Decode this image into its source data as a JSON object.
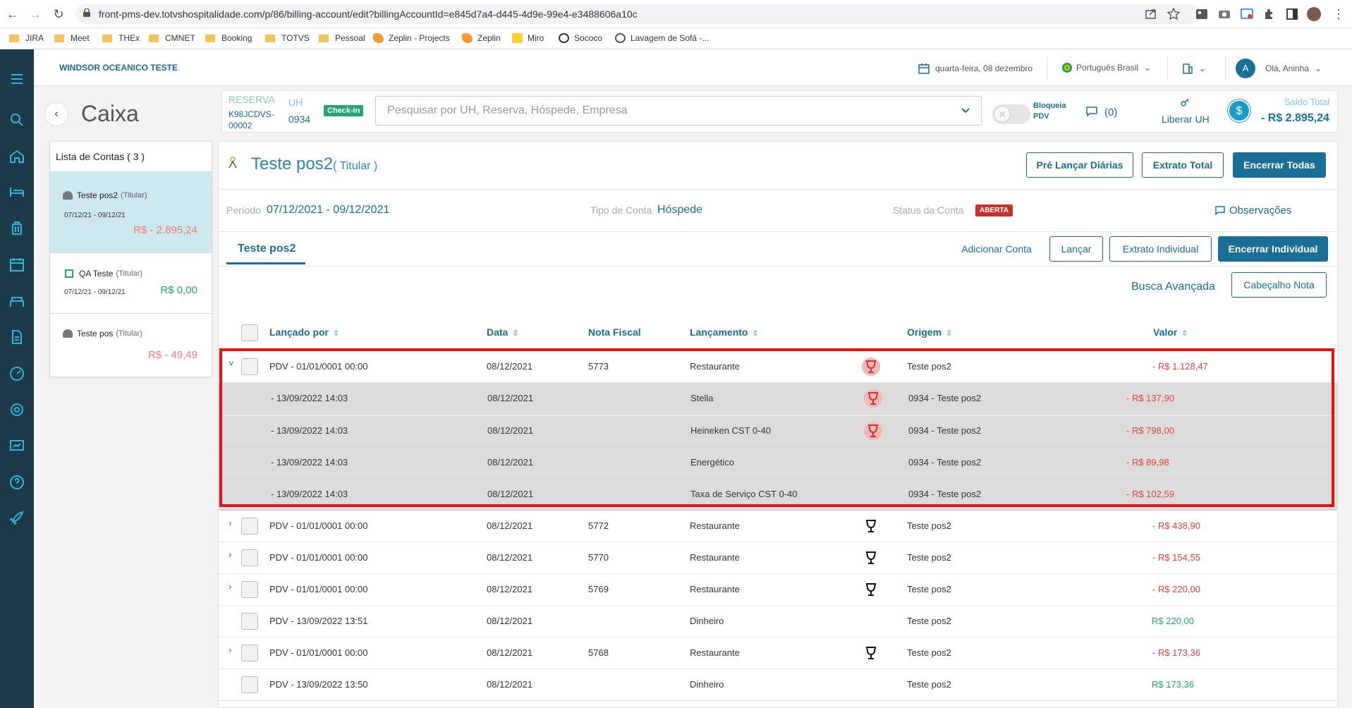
{
  "browser": {
    "url": "front-pms-dev.totvshospitalidade.com/p/86/billing-account/edit?billingAccountId=e845d7a4-d445-4d9e-99e4-e3488606a10c",
    "bookmarks": [
      {
        "label": "JIRA",
        "icon": "folder"
      },
      {
        "label": "Meet",
        "icon": "folder"
      },
      {
        "label": "THEx",
        "icon": "folder"
      },
      {
        "label": "CMNET",
        "icon": "folder"
      },
      {
        "label": "Booking",
        "icon": "folder"
      },
      {
        "label": "TOTVS",
        "icon": "folder"
      },
      {
        "label": "Pessoal",
        "icon": "folder"
      },
      {
        "label": "Zeplin - Projects",
        "icon": "zeplin"
      },
      {
        "label": "Zeplin",
        "icon": "zeplin"
      },
      {
        "label": "Miro",
        "icon": "miro"
      },
      {
        "label": "Sococo",
        "icon": "sococo"
      },
      {
        "label": "Lavagem de Sofá -...",
        "icon": "globe"
      }
    ]
  },
  "header": {
    "hotel": "WINDSOR OCEANICO TESTE",
    "date": "quarta-feira, 08 dezembro",
    "language": "Português Brasil",
    "avatar_letter": "A",
    "greeting": "Olá, Aninha"
  },
  "page": {
    "title": "Caixa"
  },
  "reservation": {
    "reserva_label": "RESERVA",
    "reserva_line1": "K98JCDVS-",
    "reserva_line2": "00002",
    "uh_label": "UH",
    "uh_value": "0934",
    "checkin_badge": "Check-In",
    "search_placeholder": "Pesquisar por UH, Reserva, Hóspede, Empresa",
    "bloqueia_line1": "Bloqueia",
    "bloqueia_line2": "PDV",
    "messages_count": "(0)",
    "liberar_uh": "Liberar UH",
    "saldo_label": "Saldo Total",
    "saldo_value": "- R$ 2.895,24"
  },
  "accounts": {
    "title": "Lista de Contas ( 3 )",
    "items": [
      {
        "name": "Teste pos2",
        "type": "(Titular)",
        "dates": "07/12/21 - 09/12/21",
        "value": "R$ - 2.895,24"
      },
      {
        "name": "QA Teste",
        "type": "(Titular)",
        "dates": "07/12/21 - 09/12/21",
        "value": "R$ 0,00"
      },
      {
        "name": "Teste pos",
        "type": "(Titular)",
        "dates": "",
        "value": "R$ - 49,49"
      }
    ]
  },
  "detail": {
    "name": "Teste pos2",
    "role": "( Titular )",
    "buttons": {
      "pre_lancar": "Pré Lançar Diárias",
      "extrato_total": "Extrato Total",
      "encerrar_todas": "Encerrar Todas"
    },
    "periodo_label": "Período",
    "periodo_value": "07/12/2021 - 09/12/2021",
    "tipo_label": "Tipo de Conta",
    "tipo_value": "Hóspede",
    "status_label": "Status da Conta",
    "status_value": "ABERTA",
    "observacoes": "Observações",
    "tab": "Teste pos2",
    "actions": {
      "adicionar": "Adicionar Conta",
      "lancar": "Lançar",
      "extrato_individual": "Extrato Individual",
      "encerrar_individual": "Encerrar Individual"
    },
    "busca": "Busca Avançada",
    "cabecalho": "Cabeçalho Nota"
  },
  "table": {
    "columns": {
      "lancado": "Lançado por",
      "data": "Data",
      "nota": "Nota Fiscal",
      "lancamento": "Lançamento",
      "origem": "Origem",
      "valor": "Valor"
    },
    "rows": [
      {
        "expand": "˅",
        "check": true,
        "lancado": "PDV - 01/01/0001 00:00",
        "data": "08/12/2021",
        "nota": "5773",
        "lancamento": "Restaurante",
        "icon": "red",
        "origem": "Teste pos2",
        "valor": "- R$ 1.128,47",
        "sub": false
      },
      {
        "expand": "",
        "check": false,
        "lancado": "- 13/09/2022 14:03",
        "data": "08/12/2021",
        "nota": "",
        "lancamento": "Stella",
        "icon": "red",
        "origem": "0934 - Teste pos2",
        "valor": "- R$ 137,90",
        "sub": true
      },
      {
        "expand": "",
        "check": false,
        "lancado": "- 13/09/2022 14:03",
        "data": "08/12/2021",
        "nota": "",
        "lancamento": "Heineken CST 0-40",
        "icon": "red",
        "origem": "0934 - Teste pos2",
        "valor": "- R$ 798,00",
        "sub": true
      },
      {
        "expand": "",
        "check": false,
        "lancado": "- 13/09/2022 14:03",
        "data": "08/12/2021",
        "nota": "",
        "lancamento": "Energético",
        "icon": "",
        "origem": "0934 - Teste pos2",
        "valor": "- R$ 89,98",
        "sub": true
      },
      {
        "expand": "",
        "check": false,
        "lancado": "- 13/09/2022 14:03",
        "data": "08/12/2021",
        "nota": "",
        "lancamento": "Taxa de Serviço CST 0-40",
        "icon": "",
        "origem": "0934 - Teste pos2",
        "valor": "- R$ 102,59",
        "sub": true
      },
      {
        "expand": "›",
        "check": true,
        "lancado": "PDV - 01/01/0001 00:00",
        "data": "08/12/2021",
        "nota": "5772",
        "lancamento": "Restaurante",
        "icon": "black",
        "origem": "Teste pos2",
        "valor": "- R$ 438,90",
        "sub": false
      },
      {
        "expand": "›",
        "check": true,
        "lancado": "PDV - 01/01/0001 00:00",
        "data": "08/12/2021",
        "nota": "5770",
        "lancamento": "Restaurante",
        "icon": "black",
        "origem": "Teste pos2",
        "valor": "- R$ 154,55",
        "sub": false
      },
      {
        "expand": "›",
        "check": true,
        "lancado": "PDV - 01/01/0001 00:00",
        "data": "08/12/2021",
        "nota": "5769",
        "lancamento": "Restaurante",
        "icon": "black",
        "origem": "Teste pos2",
        "valor": "- R$ 220,00",
        "sub": false
      },
      {
        "expand": "",
        "check": true,
        "lancado": "PDV - 13/09/2022 13:51",
        "data": "08/12/2021",
        "nota": "",
        "lancamento": "Dinheiro",
        "icon": "",
        "origem": "Teste pos2",
        "valor": "R$ 220,00",
        "sub": false
      },
      {
        "expand": "›",
        "check": true,
        "lancado": "PDV - 01/01/0001 00:00",
        "data": "08/12/2021",
        "nota": "5768",
        "lancamento": "Restaurante",
        "icon": "black",
        "origem": "Teste pos2",
        "valor": "- R$ 173,36",
        "sub": false
      },
      {
        "expand": "",
        "check": true,
        "lancado": "PDV - 13/09/2022 13:50",
        "data": "08/12/2021",
        "nota": "",
        "lancamento": "Dinheiro",
        "icon": "",
        "origem": "Teste pos2",
        "valor": "R$ 173,36",
        "sub": false
      }
    ]
  },
  "colors": {
    "sidebar": "#1c3a47",
    "primary": "#1a6f96",
    "negative": "#e0443a",
    "positive": "#22a672",
    "highlight": "#e81010"
  }
}
